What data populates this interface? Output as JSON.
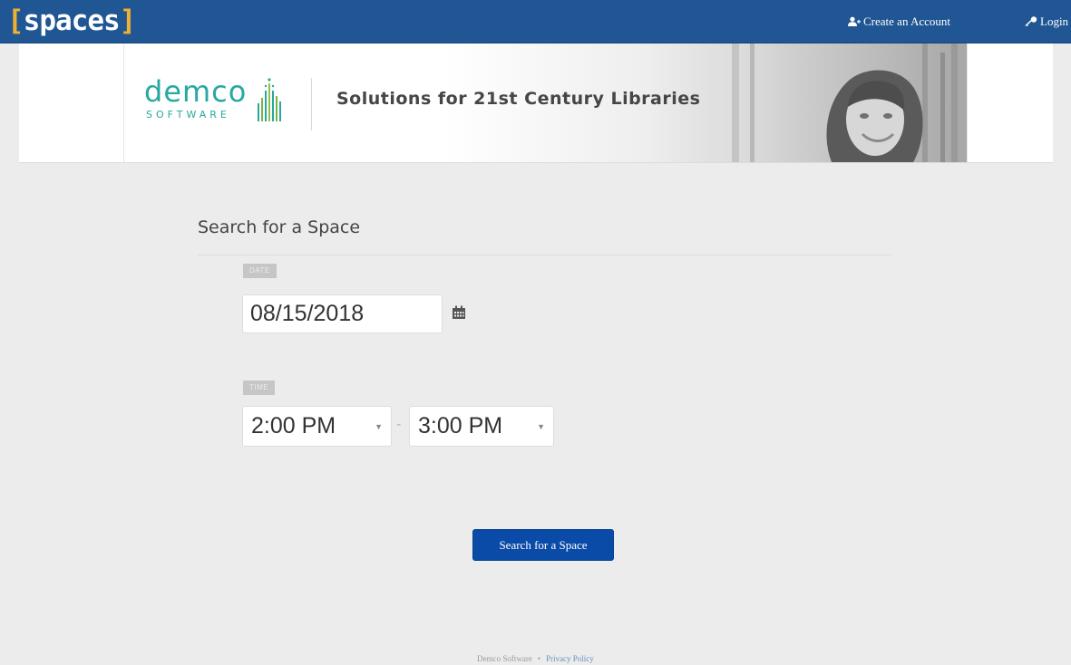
{
  "header": {
    "logo_open": "[",
    "logo_word": "spaces",
    "logo_close": "]",
    "create_account_label": "Create an Account",
    "login_label": "Login",
    "bar_color": "#1f5693"
  },
  "banner": {
    "brand_word": "DEMCO",
    "brand_sub": "SOFTWARE",
    "tagline": "Solutions for 21st Century Libraries"
  },
  "search": {
    "heading": "Search for a Space",
    "date_label": "DATE",
    "date_value": "08/15/2018",
    "time_label": "TIME",
    "start_time": "2:00 PM",
    "end_time": "3:00 PM",
    "time_separator": "-",
    "button_label": "Search for a Space",
    "button_color": "#0b4ba8"
  },
  "footer": {
    "company": "Demco Software",
    "separator": "•",
    "privacy_link": "Privacy Policy"
  },
  "icons": {
    "create_account": "add-user-icon",
    "login": "key-icon",
    "date_picker": "calendar-icon",
    "select_caret": "caret-down-icon"
  }
}
